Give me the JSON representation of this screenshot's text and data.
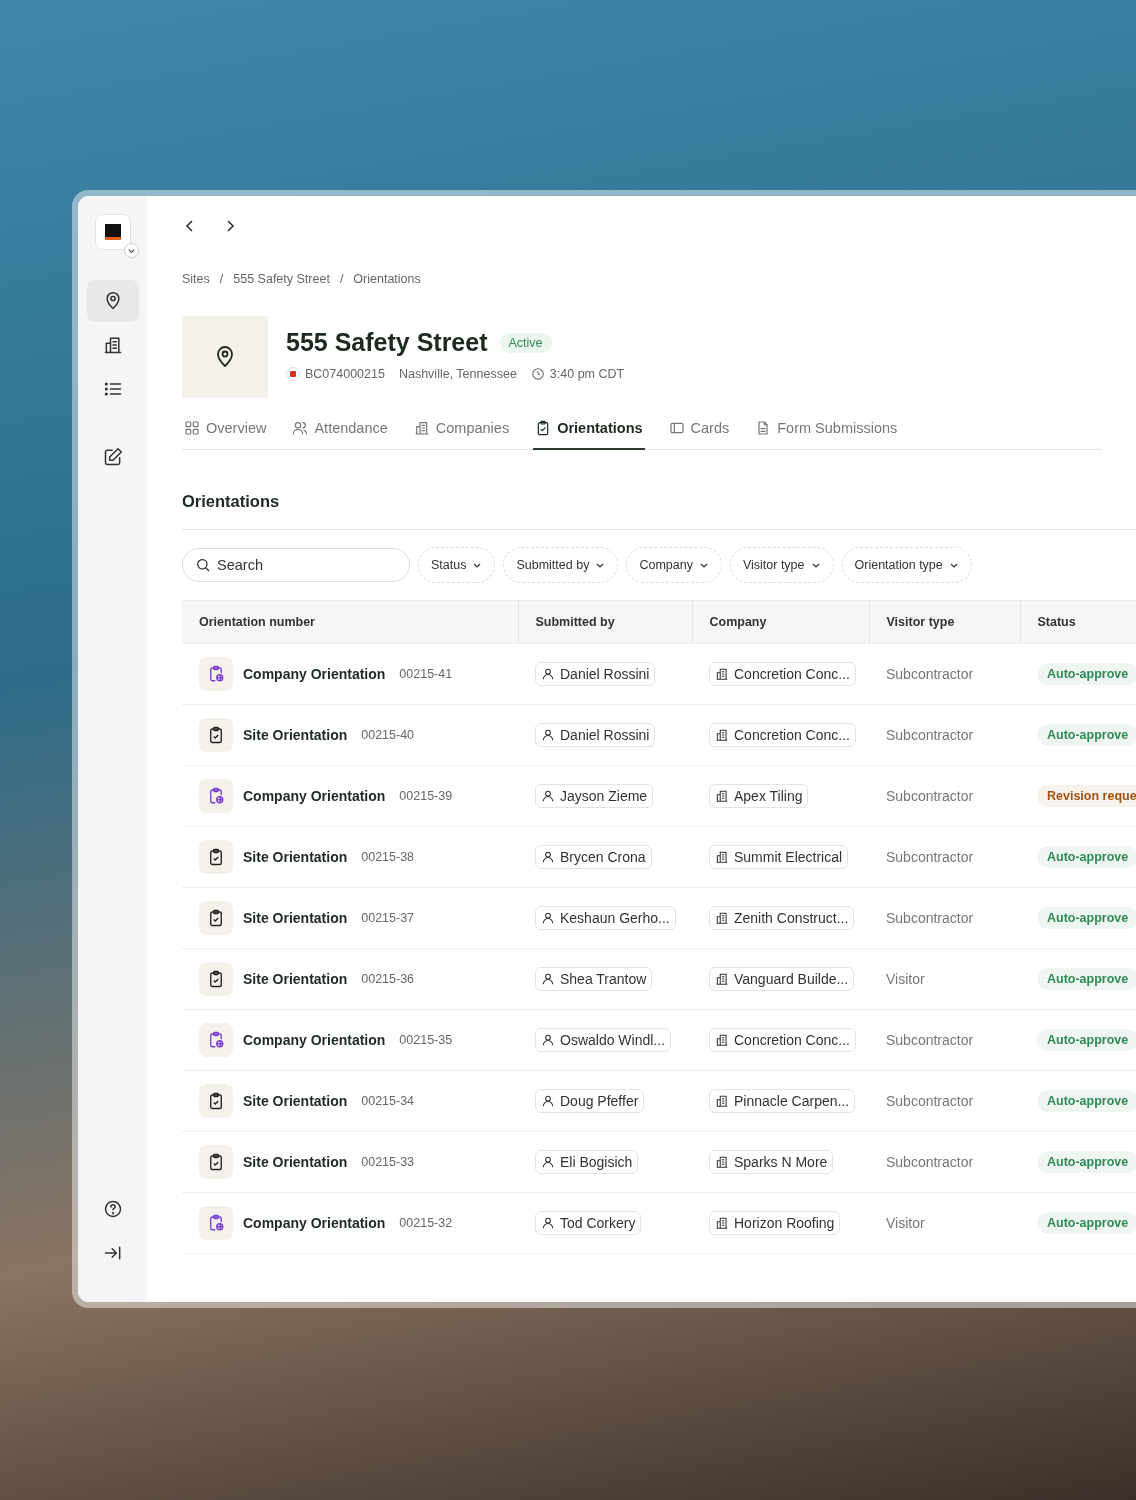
{
  "sidebar": {
    "items": [
      {
        "selected": true
      },
      {
        "selected": false
      },
      {
        "selected": false
      },
      {
        "selected": false
      }
    ]
  },
  "breadcrumb": [
    "Sites",
    "/",
    "555 Safety Street",
    "/",
    "Orientations"
  ],
  "site": {
    "name": "555 Safety Street",
    "status": "Active",
    "code": "BC074000215",
    "location": "Nashville, Tennessee",
    "time": "3:40 pm CDT"
  },
  "tabs": [
    {
      "label": "Overview",
      "selected": false
    },
    {
      "label": "Attendance",
      "selected": false
    },
    {
      "label": "Companies",
      "selected": false
    },
    {
      "label": "Orientations",
      "selected": true
    },
    {
      "label": "Cards",
      "selected": false
    },
    {
      "label": "Form Submissions",
      "selected": false
    }
  ],
  "section_title": "Orientations",
  "search": {
    "placeholder": "Search"
  },
  "filters": [
    "Status",
    "Submitted by",
    "Company",
    "Visitor type",
    "Orientation type"
  ],
  "table": {
    "columns": [
      "Orientation number",
      "Submitted by",
      "Company",
      "Visitor type",
      "Status"
    ],
    "rows": [
      {
        "kind": "company",
        "title": "Company Orientation",
        "number": "00215-41",
        "submitted_by": "Daniel Rossini",
        "company": "Concretion Conc...",
        "visitor_type": "Subcontractor",
        "status": "Auto-approve",
        "color": "#2f8a55"
      },
      {
        "kind": "site",
        "title": "Site Orientation",
        "number": "00215-40",
        "submitted_by": "Daniel Rossini",
        "company": "Concretion Conc...",
        "visitor_type": "Subcontractor",
        "status": "Auto-approve",
        "color": "#2f8a55"
      },
      {
        "kind": "company",
        "title": "Company Orientation",
        "number": "00215-39",
        "submitted_by": "Jayson Zieme",
        "company": "Apex Tiling",
        "visitor_type": "Subcontractor",
        "status": "Revision reque",
        "color": "#a3530f"
      },
      {
        "kind": "site",
        "title": "Site Orientation",
        "number": "00215-38",
        "submitted_by": "Brycen Crona",
        "company": "Summit Electrical",
        "visitor_type": "Subcontractor",
        "status": "Auto-approve",
        "color": "#2f8a55"
      },
      {
        "kind": "site",
        "title": "Site Orientation",
        "number": "00215-37",
        "submitted_by": "Keshaun Gerho...",
        "company": "Zenith Construct...",
        "visitor_type": "Subcontractor",
        "status": "Auto-approve",
        "color": "#2f8a55"
      },
      {
        "kind": "site",
        "title": "Site Orientation",
        "number": "00215-36",
        "submitted_by": "Shea Trantow",
        "company": "Vanguard Builde...",
        "visitor_type": "Visitor",
        "status": "Auto-approve",
        "color": "#2f8a55"
      },
      {
        "kind": "company",
        "title": "Company Orientation",
        "number": "00215-35",
        "submitted_by": "Oswaldo Windl...",
        "company": "Concretion Conc...",
        "visitor_type": "Subcontractor",
        "status": "Auto-approve",
        "color": "#2f8a55"
      },
      {
        "kind": "site",
        "title": "Site Orientation",
        "number": "00215-34",
        "submitted_by": "Doug Pfeffer",
        "company": "Pinnacle Carpen...",
        "visitor_type": "Subcontractor",
        "status": "Auto-approve",
        "color": "#2f8a55"
      },
      {
        "kind": "site",
        "title": "Site Orientation",
        "number": "00215-33",
        "submitted_by": "Eli Bogisich",
        "company": "Sparks N More",
        "visitor_type": "Subcontractor",
        "status": "Auto-approve",
        "color": "#2f8a55"
      },
      {
        "kind": "company",
        "title": "Company Orientation",
        "number": "00215-32",
        "submitted_by": "Tod Corkery",
        "company": "Horizon Roofing",
        "visitor_type": "Visitor",
        "status": "Auto-approve",
        "color": "#2f8a55"
      }
    ]
  }
}
